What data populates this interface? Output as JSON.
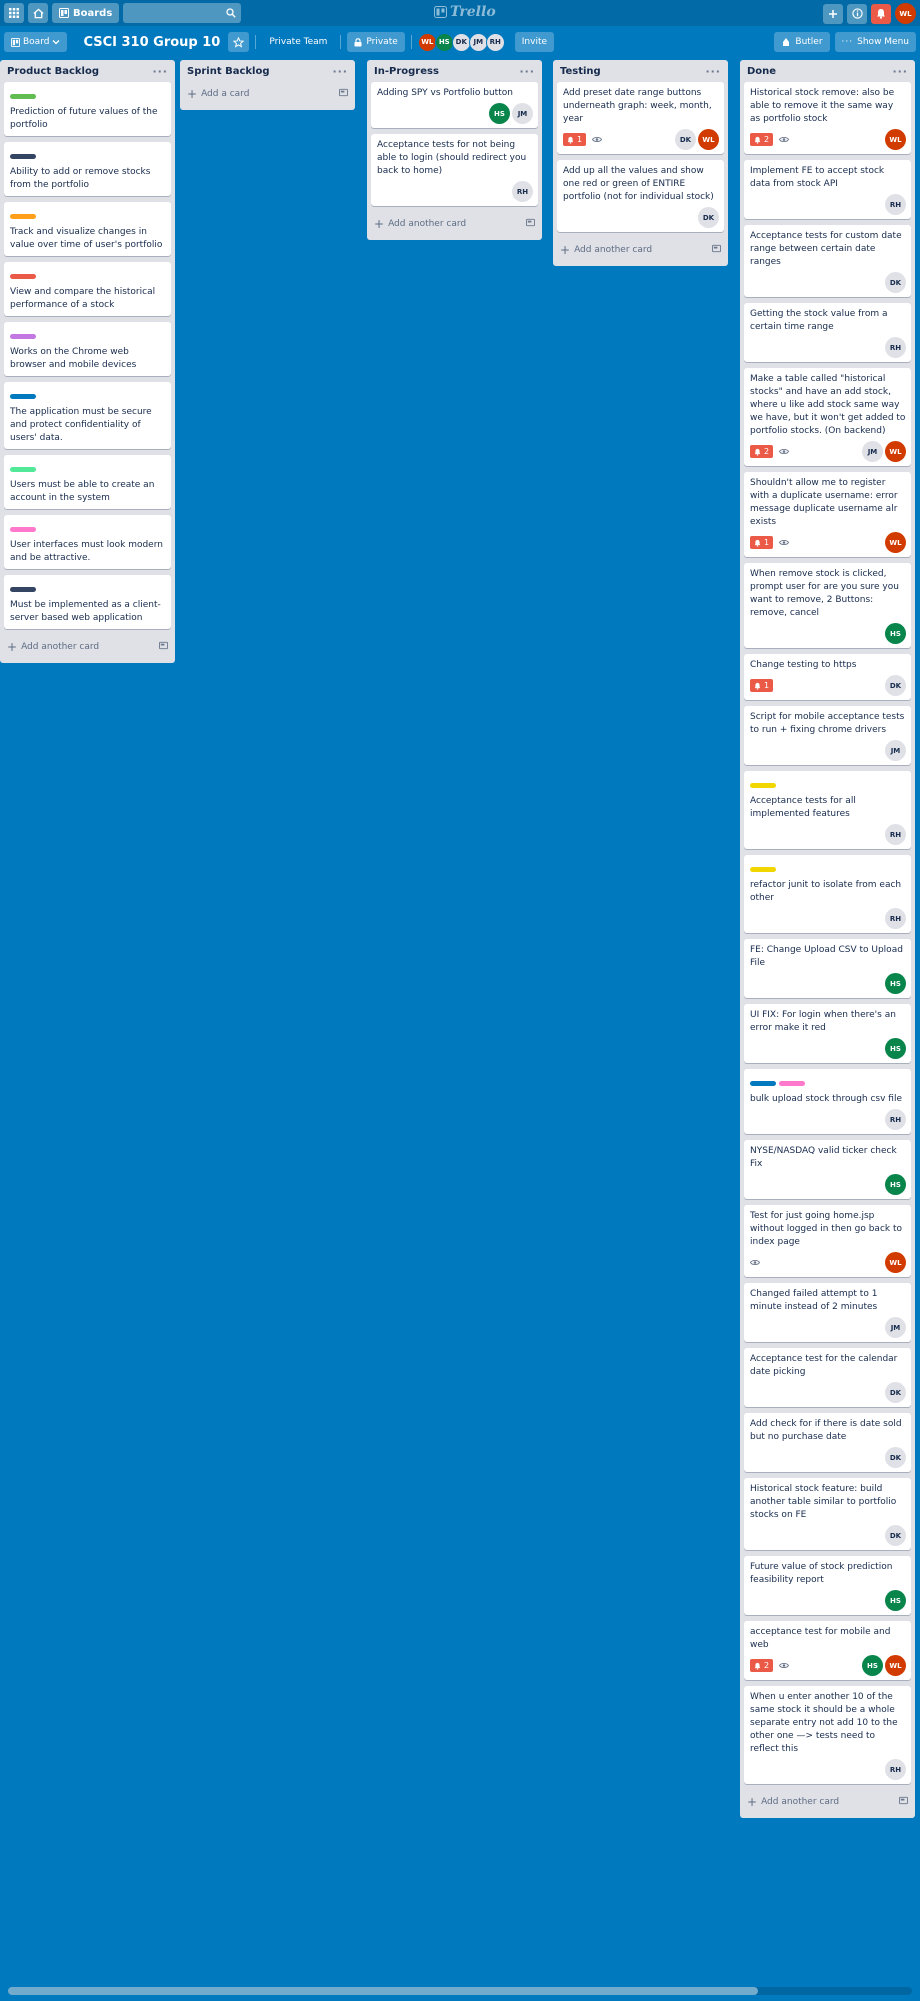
{
  "topbar": {
    "boards_label": "Boards",
    "logo_text": "Trello",
    "user_initials": "WL"
  },
  "header": {
    "board_menu_label": "Board",
    "board_title": "CSCI 310 Group 10",
    "team_label": "Private Team",
    "visibility_label": "Private",
    "members": [
      "WL",
      "HS",
      "DK",
      "JM",
      "RH"
    ],
    "invite_label": "Invite",
    "butler_label": "Butler",
    "show_menu_label": "Show Menu"
  },
  "colors": {
    "background": "#0079bf",
    "topbar": "#026aa7",
    "green": "#61bd4f",
    "navy": "#344563",
    "orange": "#ff9f1a",
    "red": "#eb5a46",
    "purple": "#c377e0",
    "blue": "#0079bf",
    "lime": "#51e898",
    "pink": "#ff78cb",
    "yellow": "#f2d600"
  },
  "lists": [
    {
      "title": "Product Backlog",
      "cards": [
        {
          "title": "Prediction of future values of the portfolio",
          "labels": [
            "green"
          ]
        },
        {
          "title": "Ability to add or remove stocks from the portfolio",
          "labels": [
            "navy"
          ]
        },
        {
          "title": "Track and visualize changes in value over time of user's portfolio",
          "labels": [
            "orange"
          ]
        },
        {
          "title": "View and compare the historical performance of a stock",
          "labels": [
            "red"
          ]
        },
        {
          "title": "Works on the Chrome web browser and mobile devices",
          "labels": [
            "purple"
          ]
        },
        {
          "title": "The application must be secure and protect confidentiality of users' data.",
          "labels": [
            "blue"
          ]
        },
        {
          "title": "Users must be able to create an account in the system",
          "labels": [
            "lime"
          ]
        },
        {
          "title": "User interfaces must look modern and be attractive.",
          "labels": [
            "pink"
          ]
        },
        {
          "title": "Must be implemented as a client-server based web application",
          "labels": [
            "navy"
          ]
        }
      ],
      "add_label": "Add another card"
    },
    {
      "title": "Sprint Backlog",
      "cards": [],
      "add_label": "Add a card"
    },
    {
      "title": "In-Progress",
      "cards": [
        {
          "title": "Adding SPY vs Portfolio button",
          "members": [
            "HS",
            "JM"
          ]
        },
        {
          "title": "Acceptance tests for not being able to login (should redirect you back to home)",
          "members": [
            "RH"
          ]
        }
      ],
      "add_label": "Add another card"
    },
    {
      "title": "Testing",
      "cards": [
        {
          "title": "Add preset date range buttons underneath graph: week, month, year",
          "notifications": "1",
          "watch": true,
          "members": [
            "DK",
            "WL"
          ]
        },
        {
          "title": "Add up all the values and show one red or green of ENTIRE portfolio (not for individual stock)",
          "members": [
            "DK"
          ]
        }
      ],
      "add_label": "Add another card"
    },
    {
      "title": "Done",
      "cards": [
        {
          "title": "Historical stock remove: also be able to remove it the same way as portfolio stock",
          "notifications": "2",
          "watch": true,
          "members": [
            "WL"
          ]
        },
        {
          "title": "Implement FE to accept stock data from stock API",
          "members": [
            "RH"
          ]
        },
        {
          "title": "Acceptance tests for custom date range between certain date ranges",
          "members": [
            "DK"
          ]
        },
        {
          "title": "Getting the stock value from a certain time range",
          "members": [
            "RH"
          ]
        },
        {
          "title": "Make a table called \"historical stocks\" and have an add stock, where u like add stock same way we have, but it won't get added to portfolio stocks. (On backend)",
          "notifications": "2",
          "watch": true,
          "members": [
            "JM",
            "WL"
          ]
        },
        {
          "title": "Shouldn't allow me to register with a duplicate username: error message duplicate username alr exists",
          "notifications": "1",
          "watch": true,
          "members": [
            "WL"
          ]
        },
        {
          "title": "When remove stock is clicked, prompt user for are you sure you want to remove, 2 Buttons: remove, cancel",
          "members": [
            "HS"
          ]
        },
        {
          "title": "Change testing to https",
          "notifications": "1",
          "members": [
            "DK"
          ]
        },
        {
          "title": "Script for mobile acceptance tests to run + fixing chrome drivers",
          "members": [
            "JM"
          ]
        },
        {
          "title": "Acceptance tests for all implemented features",
          "labels": [
            "yellow"
          ],
          "members": [
            "RH"
          ]
        },
        {
          "title": "refactor junit to isolate from each other",
          "labels": [
            "yellow"
          ],
          "members": [
            "RH"
          ]
        },
        {
          "title": "FE: Change Upload CSV to Upload File",
          "members": [
            "HS"
          ]
        },
        {
          "title": "UI FIX: For login when there's an error make it red",
          "members": [
            "HS"
          ]
        },
        {
          "title": "bulk upload stock through csv file",
          "labels": [
            "blue",
            "pink"
          ],
          "members": [
            "RH"
          ]
        },
        {
          "title": "NYSE/NASDAQ valid ticker check Fix",
          "members": [
            "HS"
          ]
        },
        {
          "title": "Test for just going home.jsp without logged in then go back to index page",
          "watch": true,
          "members": [
            "WL"
          ]
        },
        {
          "title": "Changed failed attempt to 1 minute instead of 2 minutes",
          "members": [
            "JM"
          ]
        },
        {
          "title": "Acceptance test for the calendar date picking",
          "members": [
            "DK"
          ]
        },
        {
          "title": "Add check for if there is date sold but no purchase date",
          "members": [
            "DK"
          ]
        },
        {
          "title": "Historical stock feature: build another table similar to portfolio stocks on FE",
          "members": [
            "DK"
          ]
        },
        {
          "title": "Future value of stock prediction feasibility report",
          "members": [
            "HS"
          ]
        },
        {
          "title": "acceptance test for mobile and web",
          "notifications": "2",
          "watch": true,
          "members": [
            "HS",
            "WL"
          ]
        },
        {
          "title": "When u enter another 10 of the same stock it should be a whole separate entry not add 10 to the other one —> tests need to reflect this",
          "members": [
            "RH"
          ]
        }
      ],
      "add_label": "Add another card"
    }
  ]
}
